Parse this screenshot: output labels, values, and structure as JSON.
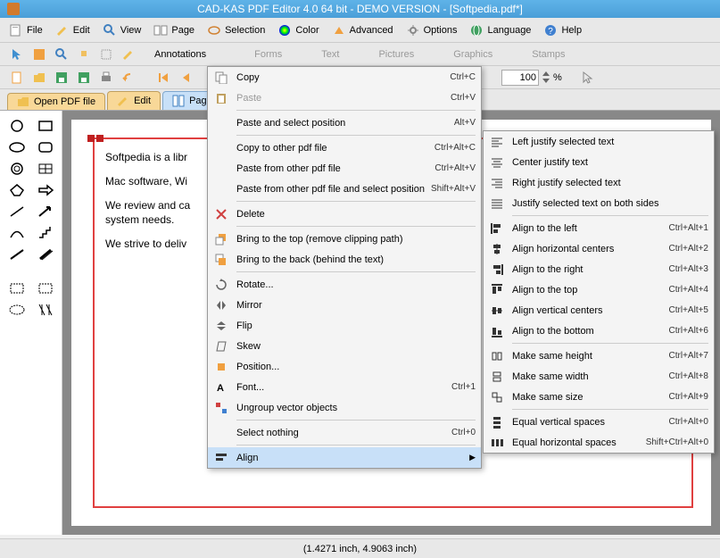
{
  "title": "CAD-KAS PDF Editor 4.0 64 bit - DEMO VERSION - [Softpedia.pdf*]",
  "menu": {
    "file": "File",
    "edit": "Edit",
    "view": "View",
    "page": "Page",
    "selection": "Selection",
    "color": "Color",
    "advanced": "Advanced",
    "options": "Options",
    "language": "Language",
    "help": "Help"
  },
  "toolbar2": {
    "annotations": "Annotations",
    "forms": "Forms",
    "text": "Text",
    "pictures": "Pictures",
    "graphics": "Graphics",
    "stamps": "Stamps"
  },
  "zoom": {
    "value": "100",
    "pct": "%"
  },
  "tabs": {
    "open": "Open PDF file",
    "edit": "Edit",
    "pages": "Pages"
  },
  "doc": {
    "p1": "Softpedia is a libr",
    "p2": "Mac software, Wi",
    "p3": "We review and ca",
    "p4": "system needs.",
    "p5": "We strive to deliv"
  },
  "ctx": {
    "copy": "Copy",
    "copy_sc": "Ctrl+C",
    "paste": "Paste",
    "paste_sc": "Ctrl+V",
    "paste_sel": "Paste and select position",
    "paste_sel_sc": "Alt+V",
    "copy_other": "Copy to other pdf file",
    "copy_other_sc": "Ctrl+Alt+C",
    "paste_other": "Paste from other pdf file",
    "paste_other_sc": "Ctrl+Alt+V",
    "paste_other_sel": "Paste from other pdf file and select position",
    "paste_other_sel_sc": "Shift+Alt+V",
    "delete": "Delete",
    "bring_top": "Bring to the top (remove clipping path)",
    "bring_back": "Bring to the back (behind the text)",
    "rotate": "Rotate...",
    "mirror": "Mirror",
    "flip": "Flip",
    "skew": "Skew",
    "position": "Position...",
    "font": "Font...",
    "font_sc": "Ctrl+1",
    "ungroup": "Ungroup vector objects",
    "select_nothing": "Select nothing",
    "select_nothing_sc": "Ctrl+0",
    "align": "Align"
  },
  "sub": {
    "left_just": "Left justify selected text",
    "center_just": "Center justify text",
    "right_just": "Right justify selected text",
    "justify_both": "Justify selected text on both sides",
    "align_left": "Align to the left",
    "align_left_sc": "Ctrl+Alt+1",
    "align_hc": "Align horizontal centers",
    "align_hc_sc": "Ctrl+Alt+2",
    "align_right": "Align to the right",
    "align_right_sc": "Ctrl+Alt+3",
    "align_top": "Align to the top",
    "align_top_sc": "Ctrl+Alt+4",
    "align_vc": "Align vertical centers",
    "align_vc_sc": "Ctrl+Alt+5",
    "align_bottom": "Align to the bottom",
    "align_bottom_sc": "Ctrl+Alt+6",
    "same_h": "Make same height",
    "same_h_sc": "Ctrl+Alt+7",
    "same_w": "Make same width",
    "same_w_sc": "Ctrl+Alt+8",
    "same_s": "Make same size",
    "same_s_sc": "Ctrl+Alt+9",
    "eq_v": "Equal vertical spaces",
    "eq_v_sc": "Ctrl+Alt+0",
    "eq_h": "Equal horizontal spaces",
    "eq_h_sc": "Shift+Ctrl+Alt+0"
  },
  "status": "(1.4271 inch, 4.9063 inch)"
}
